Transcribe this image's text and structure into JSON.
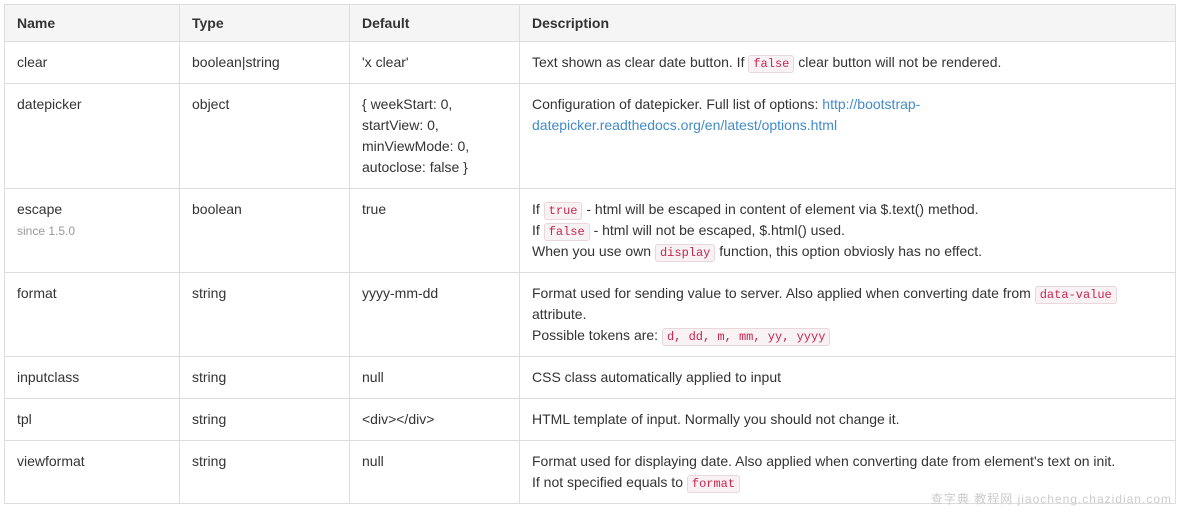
{
  "columns": {
    "name": "Name",
    "type": "Type",
    "default": "Default",
    "description": "Description"
  },
  "rows": [
    {
      "name": "clear",
      "since": "",
      "type": "boolean|string",
      "default": "'x clear'",
      "desc": [
        {
          "t": "text",
          "v": "Text shown as clear date button. If "
        },
        {
          "t": "code",
          "v": "false"
        },
        {
          "t": "text",
          "v": " clear button will not be rendered."
        }
      ]
    },
    {
      "name": "datepicker",
      "since": "",
      "type": "object",
      "default": "{ weekStart: 0, startView: 0, minViewMode: 0, autoclose: false }",
      "desc": [
        {
          "t": "text",
          "v": "Configuration of datepicker. Full list of options: "
        },
        {
          "t": "link",
          "v": "http://bootstrap-datepicker.readthedocs.org/en/latest/options.html"
        }
      ]
    },
    {
      "name": "escape",
      "since": "since 1.5.0",
      "type": "boolean",
      "default": "true",
      "desc": [
        {
          "t": "text",
          "v": "If "
        },
        {
          "t": "code",
          "v": "true"
        },
        {
          "t": "text",
          "v": " - html will be escaped in content of element via $.text() method."
        },
        {
          "t": "br"
        },
        {
          "t": "text",
          "v": "If "
        },
        {
          "t": "code",
          "v": "false"
        },
        {
          "t": "text",
          "v": " - html will not be escaped, $.html() used."
        },
        {
          "t": "br"
        },
        {
          "t": "text",
          "v": "When you use own "
        },
        {
          "t": "code",
          "v": "display"
        },
        {
          "t": "text",
          "v": " function, this option obviosly has no effect."
        }
      ]
    },
    {
      "name": "format",
      "since": "",
      "type": "string",
      "default": "yyyy-mm-dd",
      "desc": [
        {
          "t": "text",
          "v": "Format used for sending value to server. Also applied when converting date from "
        },
        {
          "t": "code",
          "v": "data-value"
        },
        {
          "t": "text",
          "v": " attribute."
        },
        {
          "t": "br"
        },
        {
          "t": "text",
          "v": "Possible tokens are: "
        },
        {
          "t": "code",
          "v": "d, dd, m, mm, yy, yyyy"
        }
      ]
    },
    {
      "name": "inputclass",
      "since": "",
      "type": "string",
      "default": "null",
      "desc": [
        {
          "t": "text",
          "v": "CSS class automatically applied to input"
        }
      ]
    },
    {
      "name": "tpl",
      "since": "",
      "type": "string",
      "default": "<div></div>",
      "desc": [
        {
          "t": "text",
          "v": "HTML template of input. Normally you should not change it."
        }
      ]
    },
    {
      "name": "viewformat",
      "since": "",
      "type": "string",
      "default": "null",
      "desc": [
        {
          "t": "text",
          "v": "Format used for displaying date. Also applied when converting date from element's text on init."
        },
        {
          "t": "br"
        },
        {
          "t": "text",
          "v": "If not specified equals to "
        },
        {
          "t": "code",
          "v": "format"
        }
      ]
    }
  ],
  "watermark": "查字典 教程网  jiaocheng.chazidian.com"
}
